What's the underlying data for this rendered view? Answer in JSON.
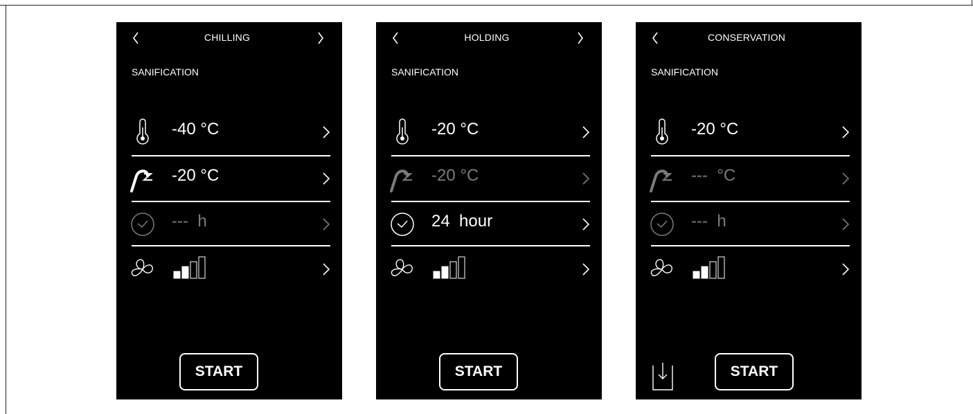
{
  "panels": [
    {
      "title": "CHILLING",
      "subtitle": "SANIFICATION",
      "rows": [
        {
          "icon": "thermometer-icon",
          "value": "-40 °C",
          "dim": false
        },
        {
          "icon": "probe-icon",
          "value": "-20 °C",
          "dim": false
        },
        {
          "icon": "clock-icon",
          "value": "---  h",
          "dim": true
        },
        {
          "icon": "fan-icon",
          "fan_speed_level": 2,
          "fan_speed_max": 4,
          "dim": false
        }
      ],
      "start_label": "START"
    },
    {
      "title": "HOLDING",
      "subtitle": "SANIFICATION",
      "rows": [
        {
          "icon": "thermometer-icon",
          "value": "-20 °C",
          "dim": false
        },
        {
          "icon": "probe-icon",
          "value": "-20 °C",
          "dim": true
        },
        {
          "icon": "clock-icon",
          "value": "24  hour",
          "dim": false
        },
        {
          "icon": "fan-icon",
          "fan_speed_level": 2,
          "fan_speed_max": 4,
          "dim": false
        }
      ],
      "start_label": "START"
    },
    {
      "title": "CONSERVATION",
      "subtitle": "SANIFICATION",
      "rows": [
        {
          "icon": "thermometer-icon",
          "value": "-20 °C",
          "dim": false
        },
        {
          "icon": "probe-icon",
          "value": "---  °C",
          "dim": true
        },
        {
          "icon": "clock-icon",
          "value": "---  h",
          "dim": true
        },
        {
          "icon": "fan-icon",
          "fan_speed_level": 2,
          "fan_speed_max": 4,
          "dim": false
        }
      ],
      "start_label": "START",
      "download_icon": "download-icon"
    }
  ],
  "colors": {
    "panel_bg": "#000000",
    "active": "#ffffff",
    "dimmed": "#7b7b7b",
    "page_bg": "#ffffff"
  }
}
